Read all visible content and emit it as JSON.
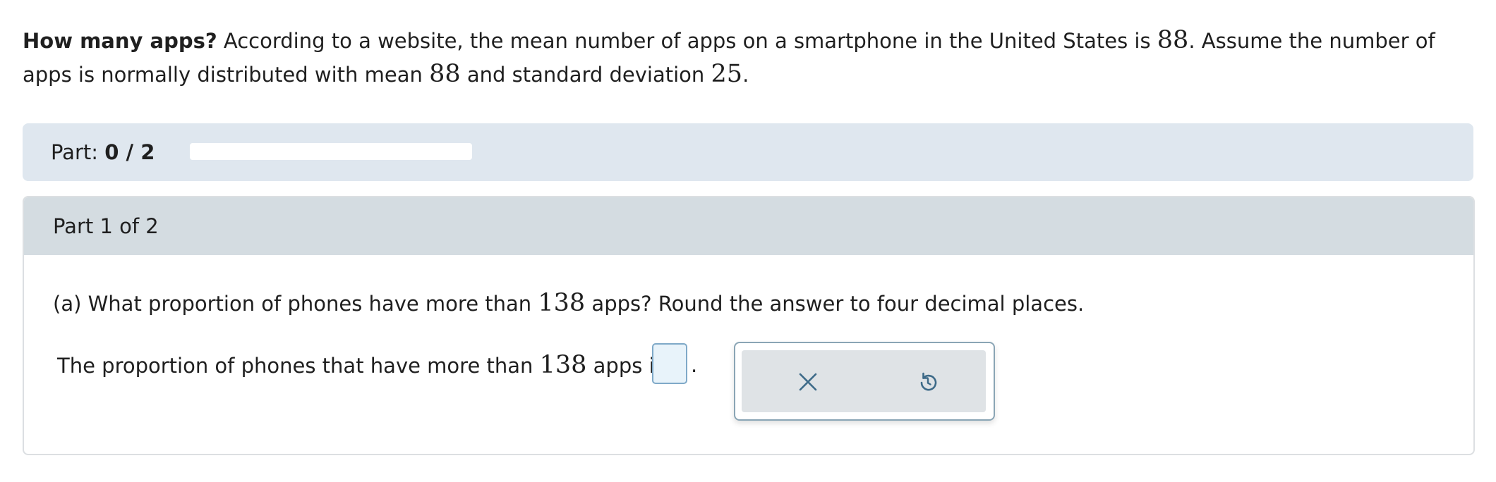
{
  "problem": {
    "title": "How many apps?",
    "text_1": " According to a website, the mean number of apps on a smartphone in the United States is ",
    "mean_1": "88",
    "text_2": ". Assume the number of apps is normally distributed with mean ",
    "mean_2": "88",
    "text_3": " and standard deviation ",
    "sd": "25",
    "text_4": "."
  },
  "progress": {
    "label": "Part: ",
    "value": "0 / 2",
    "fraction": 0
  },
  "part": {
    "header": "Part 1 of 2",
    "question_prefix": "(a) What proportion of phones have more than ",
    "question_number": "138",
    "question_suffix": " apps? Round the answer to four decimal places.",
    "answer_prefix": "The proportion of phones that have more than ",
    "answer_number": "138",
    "answer_suffix": " apps is ",
    "answer_value": "",
    "answer_end": "."
  },
  "tools": {
    "clear_icon": "x-icon",
    "undo_icon": "undo-icon"
  },
  "colors": {
    "progress_panel": "#dfe7ef",
    "part_header": "#d4dce1",
    "input_bg": "#e8f3fa",
    "input_border": "#7fa9c8",
    "icon": "#3d6a88"
  }
}
